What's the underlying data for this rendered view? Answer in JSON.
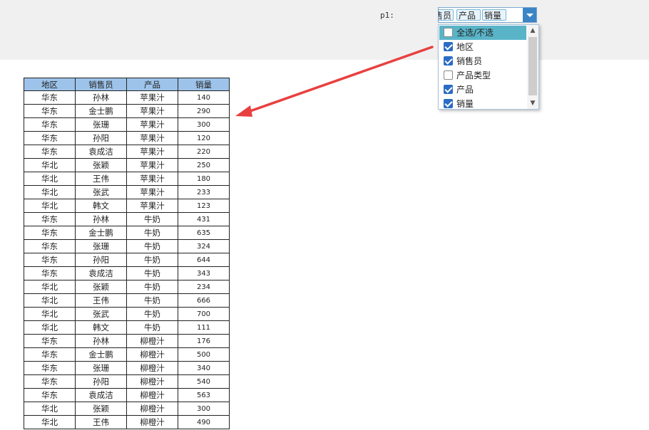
{
  "param": {
    "label": "p1:"
  },
  "combo": {
    "chips": [
      "售员",
      "产品",
      "销量"
    ],
    "button_color": "#3b85c7"
  },
  "dropdown": {
    "items": [
      {
        "label": "全选/不选",
        "checked": false,
        "highlighted": true
      },
      {
        "label": "地区",
        "checked": true,
        "highlighted": false
      },
      {
        "label": "销售员",
        "checked": true,
        "highlighted": false
      },
      {
        "label": "产品类型",
        "checked": false,
        "highlighted": false
      },
      {
        "label": "产品",
        "checked": true,
        "highlighted": false
      },
      {
        "label": "销量",
        "checked": true,
        "highlighted": false
      }
    ],
    "highlight_color": "#5ab4c8"
  },
  "table": {
    "header_color": "#9dc3ea",
    "columns": [
      "地区",
      "销售员",
      "产品",
      "销量"
    ],
    "rows": [
      [
        "华东",
        "孙林",
        "苹果汁",
        "140"
      ],
      [
        "华东",
        "金士鹏",
        "苹果汁",
        "290"
      ],
      [
        "华东",
        "张珊",
        "苹果汁",
        "300"
      ],
      [
        "华东",
        "孙阳",
        "苹果汁",
        "120"
      ],
      [
        "华东",
        "袁成洁",
        "苹果汁",
        "220"
      ],
      [
        "华北",
        "张颖",
        "苹果汁",
        "250"
      ],
      [
        "华北",
        "王伟",
        "苹果汁",
        "180"
      ],
      [
        "华北",
        "张武",
        "苹果汁",
        "233"
      ],
      [
        "华北",
        "韩文",
        "苹果汁",
        "123"
      ],
      [
        "华东",
        "孙林",
        "牛奶",
        "431"
      ],
      [
        "华东",
        "金士鹏",
        "牛奶",
        "635"
      ],
      [
        "华东",
        "张珊",
        "牛奶",
        "324"
      ],
      [
        "华东",
        "孙阳",
        "牛奶",
        "644"
      ],
      [
        "华东",
        "袁成洁",
        "牛奶",
        "343"
      ],
      [
        "华北",
        "张颖",
        "牛奶",
        "234"
      ],
      [
        "华北",
        "王伟",
        "牛奶",
        "666"
      ],
      [
        "华北",
        "张武",
        "牛奶",
        "700"
      ],
      [
        "华北",
        "韩文",
        "牛奶",
        "111"
      ],
      [
        "华东",
        "孙林",
        "柳橙汁",
        "176"
      ],
      [
        "华东",
        "金士鹏",
        "柳橙汁",
        "500"
      ],
      [
        "华东",
        "张珊",
        "柳橙汁",
        "340"
      ],
      [
        "华东",
        "孙阳",
        "柳橙汁",
        "540"
      ],
      [
        "华东",
        "袁成洁",
        "柳橙汁",
        "563"
      ],
      [
        "华北",
        "张颖",
        "柳橙汁",
        "300"
      ],
      [
        "华北",
        "王伟",
        "柳橙汁",
        "490"
      ]
    ]
  },
  "annotation": {
    "arrow_color": "#e8403f"
  }
}
